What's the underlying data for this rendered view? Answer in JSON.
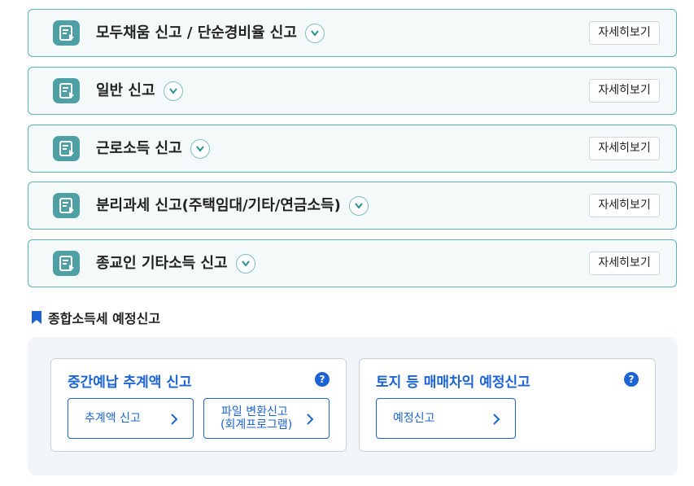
{
  "accordions": [
    {
      "title": "모두채움 신고 / 단순경비율 신고",
      "detail": "자세히보기"
    },
    {
      "title": "일반 신고",
      "detail": "자세히보기"
    },
    {
      "title": "근로소득 신고",
      "detail": "자세히보기"
    },
    {
      "title": "분리과세 신고(주택임대/기타/연금소득)",
      "detail": "자세히보기"
    },
    {
      "title": "종교인 기타소득 신고",
      "detail": "자세히보기"
    }
  ],
  "estimated": {
    "section_title": "종합소득세 예정신고",
    "cards": [
      {
        "title": "중간예납 추계액 신고",
        "help": "?",
        "actions": [
          {
            "line1": "추계액 신고",
            "line2": ""
          },
          {
            "line1": "파일 변환신고",
            "line2": "(회계프로그램)"
          }
        ]
      },
      {
        "title": "토지 등 매매차익 예정신고",
        "help": "?",
        "actions": [
          {
            "line1": "예정신고",
            "line2": ""
          }
        ]
      }
    ]
  },
  "colors": {
    "accent_teal": "#4ea0a4",
    "accent_blue": "#1c63d5"
  }
}
